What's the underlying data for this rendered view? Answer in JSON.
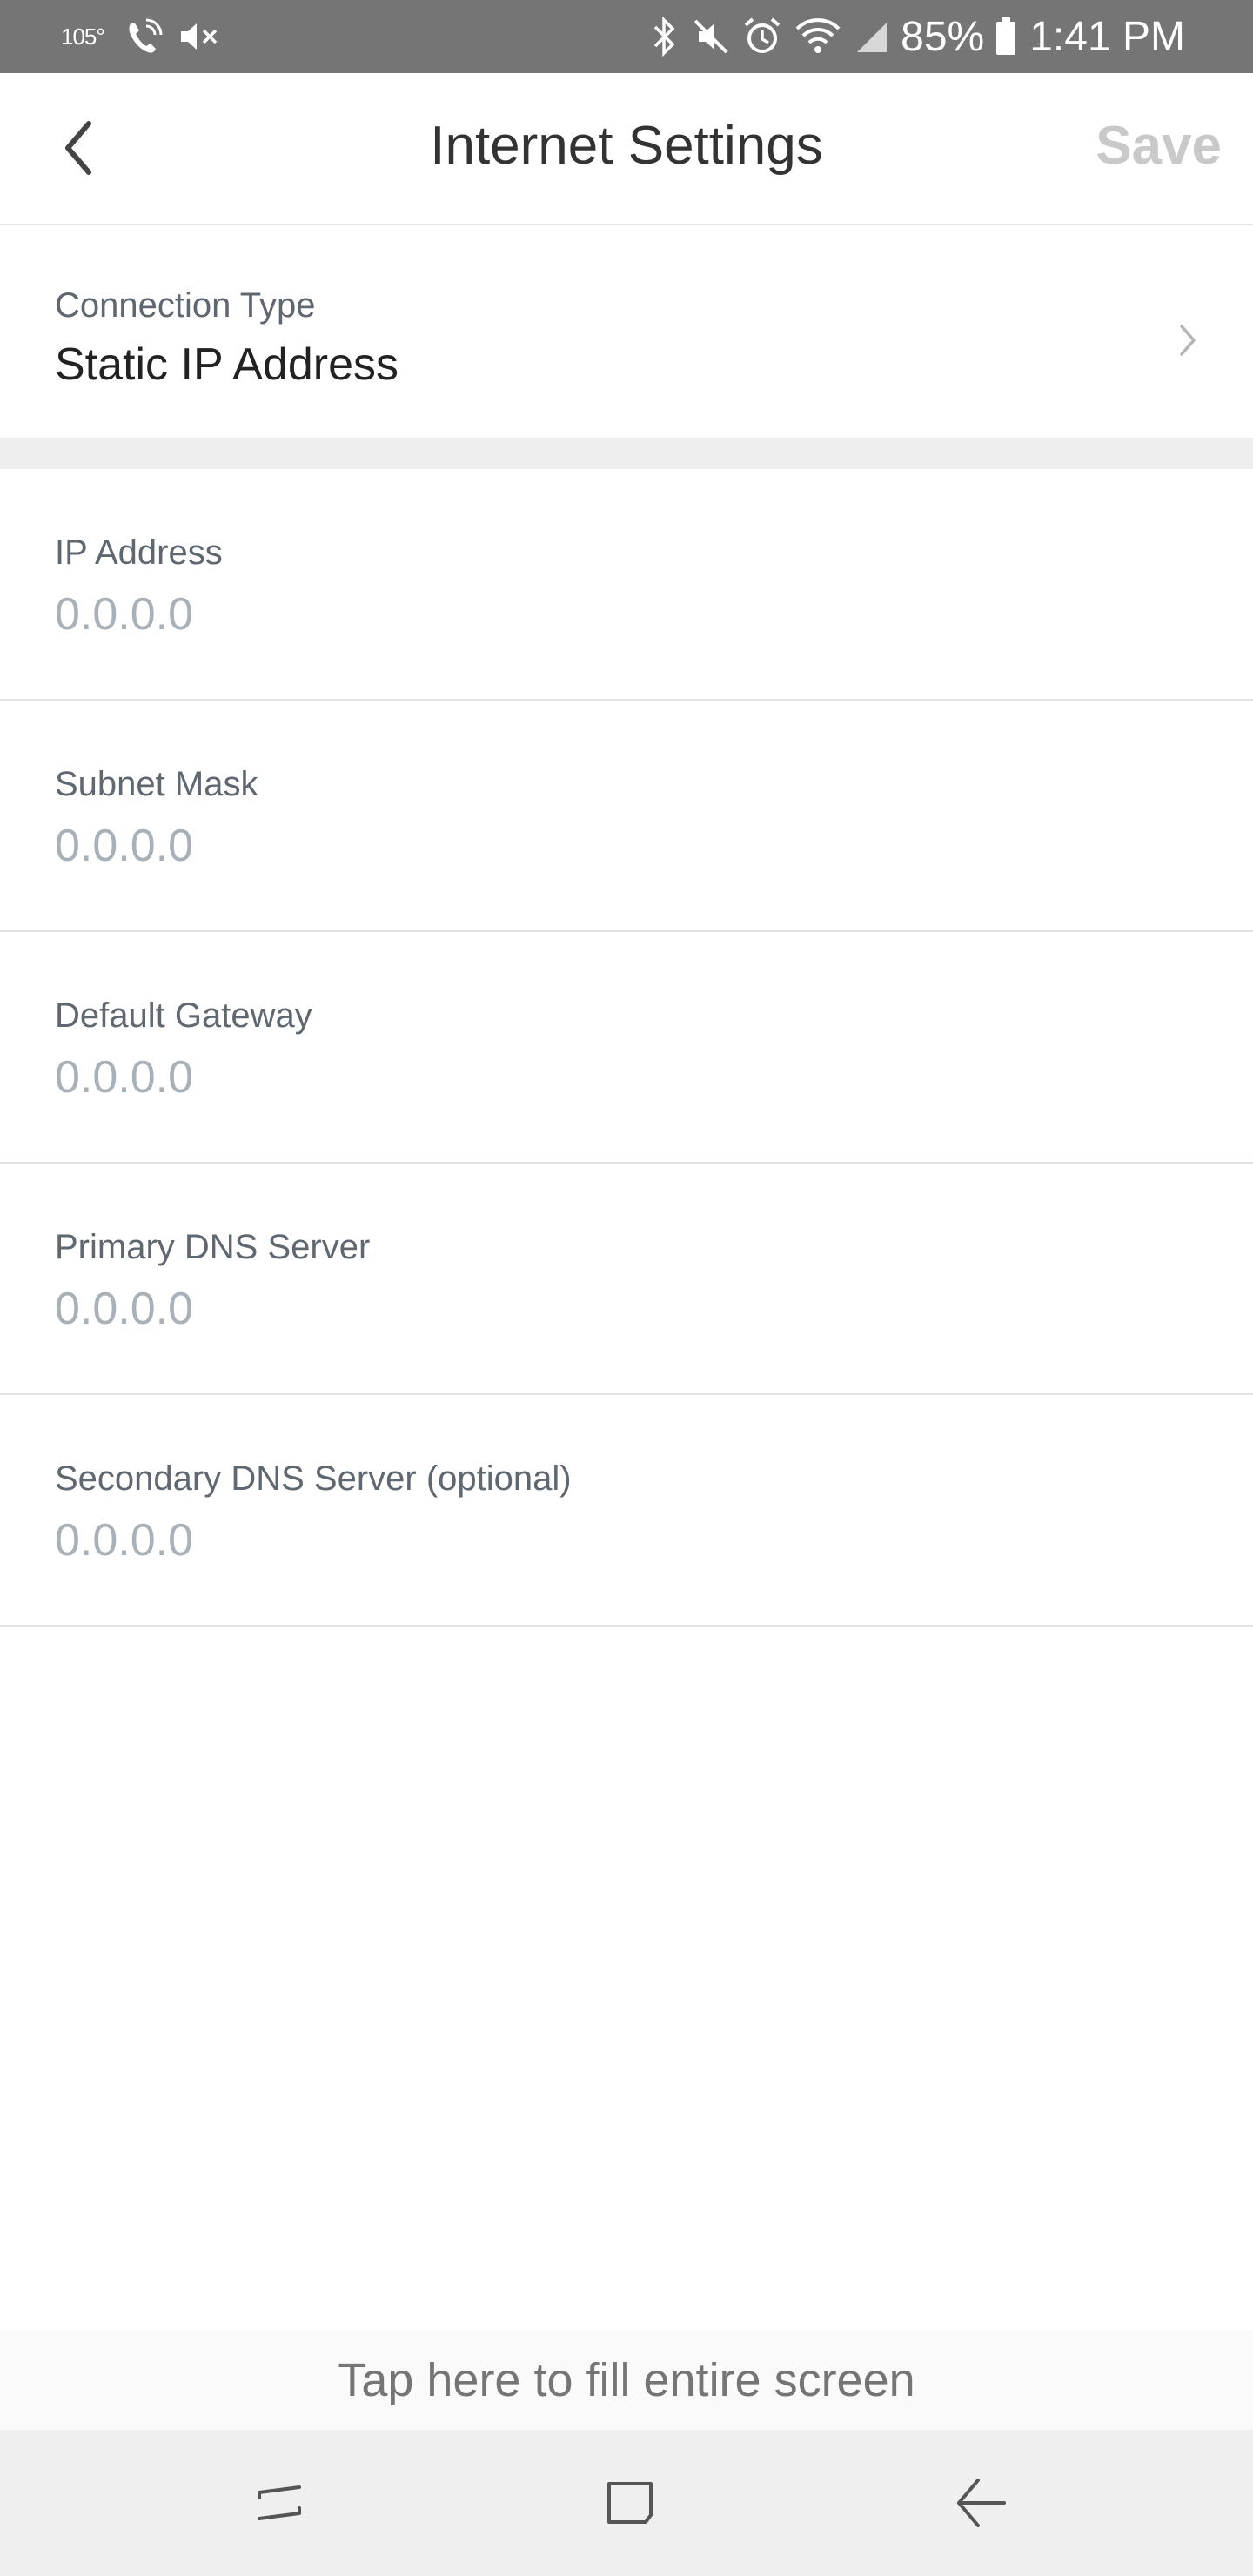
{
  "status_bar": {
    "temperature": "105°",
    "battery_percent": "85%",
    "time": "1:41 PM",
    "icons": [
      "wifi-calling-icon",
      "mute-icon",
      "bluetooth-icon",
      "vibrate-off-icon",
      "alarm-icon",
      "wifi-icon",
      "signal-icon",
      "battery-icon"
    ]
  },
  "header": {
    "title": "Internet Settings",
    "save_label": "Save",
    "save_color": "#c9c9c9"
  },
  "connection_type": {
    "label": "Connection Type",
    "value": "Static IP Address"
  },
  "fields": [
    {
      "label": "IP Address",
      "placeholder": "0.0.0.0",
      "value": ""
    },
    {
      "label": "Subnet Mask",
      "placeholder": "0.0.0.0",
      "value": ""
    },
    {
      "label": "Default Gateway",
      "placeholder": "0.0.0.0",
      "value": ""
    },
    {
      "label": "Primary DNS Server",
      "placeholder": "0.0.0.0",
      "value": ""
    },
    {
      "label": "Secondary DNS Server (optional)",
      "placeholder": "0.0.0.0",
      "value": ""
    }
  ],
  "bottom_banner": {
    "text": "Tap here to fill entire screen"
  },
  "nav_bar": {
    "buttons": [
      "recent-apps",
      "home",
      "back"
    ]
  }
}
